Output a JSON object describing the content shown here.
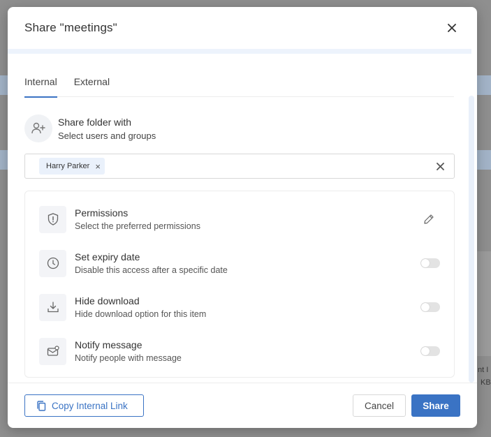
{
  "modal": {
    "title": "Share \"meetings\"",
    "close_icon": "close-icon"
  },
  "tabs": [
    {
      "label": "Internal",
      "active": true
    },
    {
      "label": "External",
      "active": false
    }
  ],
  "share_with": {
    "title": "Share folder with",
    "subtitle": "Select users and groups",
    "icon": "add-user-icon"
  },
  "selected_users": [
    {
      "name": "Harry Parker"
    }
  ],
  "options": [
    {
      "title": "Permissions",
      "subtitle": "Select the preferred permissions",
      "icon": "shield-alert-icon",
      "action": "edit"
    },
    {
      "title": "Set expiry date",
      "subtitle": "Disable this access after a specific date",
      "icon": "clock-icon",
      "action": "toggle",
      "enabled": false
    },
    {
      "title": "Hide download",
      "subtitle": "Hide download option for this item",
      "icon": "download-icon",
      "action": "toggle",
      "enabled": false
    },
    {
      "title": "Notify message",
      "subtitle": "Notify people with message",
      "icon": "mail-notify-icon",
      "action": "toggle",
      "enabled": false
    }
  ],
  "footer": {
    "copy_link_label": "Copy Internal Link",
    "cancel_label": "Cancel",
    "share_label": "Share"
  },
  "background": {
    "right_text_1": "nt I",
    "right_text_2": "KB"
  },
  "colors": {
    "accent": "#3a73c4",
    "header_band": "#edf3fc",
    "overlay": "#8a8a8a"
  }
}
